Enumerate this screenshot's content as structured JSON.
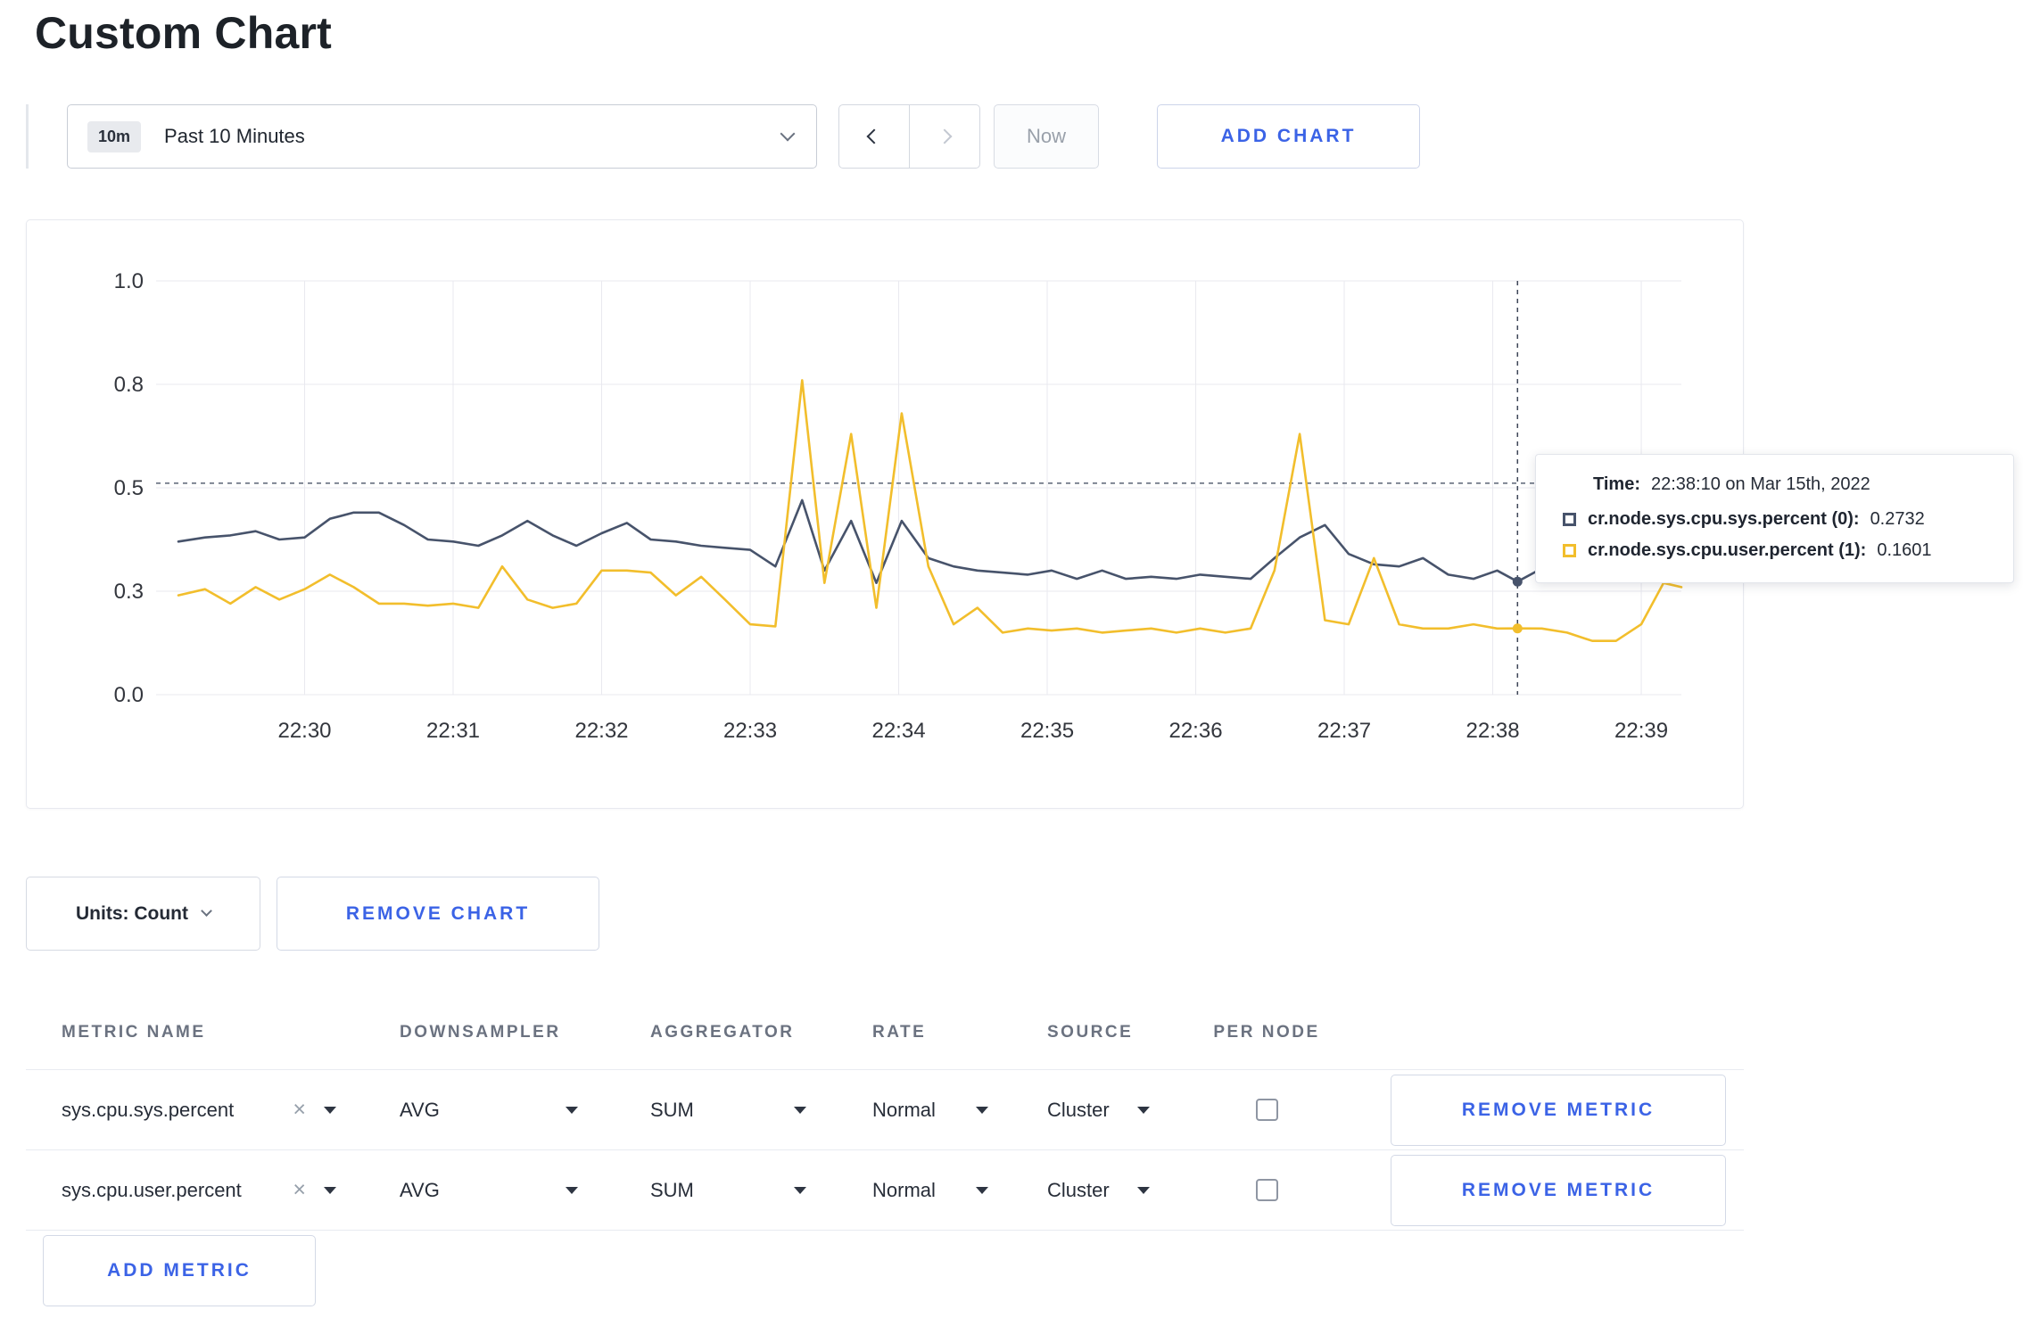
{
  "page": {
    "title": "Custom Chart"
  },
  "toolbar": {
    "time_badge": "10m",
    "time_label": "Past 10 Minutes",
    "now_label": "Now",
    "add_chart_label": "ADD CHART"
  },
  "tooltip": {
    "time_label": "Time:",
    "time_value": "22:38:10 on Mar 15th, 2022",
    "series": [
      {
        "name": "cr.node.sys.cpu.sys.percent (0):",
        "value": "0.2732",
        "color": "#47536b"
      },
      {
        "name": "cr.node.sys.cpu.user.percent (1):",
        "value": "0.1601",
        "color": "#F2BE2C"
      }
    ]
  },
  "chart_footer": {
    "units_label": "Units: Count",
    "remove_chart_label": "REMOVE CHART"
  },
  "metrics_table": {
    "headers": [
      "METRIC NAME",
      "DOWNSAMPLER",
      "AGGREGATOR",
      "RATE",
      "SOURCE",
      "PER NODE"
    ],
    "rows": [
      {
        "metric": "sys.cpu.sys.percent",
        "downsampler": "AVG",
        "aggregator": "SUM",
        "rate": "Normal",
        "source": "Cluster",
        "per_node": false,
        "action": "REMOVE METRIC"
      },
      {
        "metric": "sys.cpu.user.percent",
        "downsampler": "AVG",
        "aggregator": "SUM",
        "rate": "Normal",
        "source": "Cluster",
        "per_node": false,
        "action": "REMOVE METRIC"
      }
    ],
    "add_metric_label": "ADD METRIC"
  },
  "chart_data": {
    "type": "line",
    "ylim": [
      0,
      1
    ],
    "x_range_minutes": [
      -1.0,
      9.27
    ],
    "x_ticks": [
      "22:30",
      "22:31",
      "22:32",
      "22:33",
      "22:34",
      "22:35",
      "22:36",
      "22:37",
      "22:38",
      "22:39"
    ],
    "y_ticks": [
      {
        "label": "1.0",
        "value": 1.0
      },
      {
        "label": "0.8",
        "value": 0.75
      },
      {
        "label": "0.5",
        "value": 0.5
      },
      {
        "label": "0.3",
        "value": 0.25
      },
      {
        "label": "0.0",
        "value": 0.0
      }
    ],
    "grid": true,
    "crosshair": {
      "t_minutes": 8.1667,
      "time": "22:38:10",
      "hline_value": 0.511,
      "values": [
        0.2732,
        0.1601
      ]
    },
    "series": [
      {
        "name": "cr.node.sys.cpu.sys.percent",
        "color": "#47536b",
        "points": [
          [
            -0.85,
            0.37
          ],
          [
            -0.67,
            0.38
          ],
          [
            -0.5,
            0.385
          ],
          [
            -0.33,
            0.395
          ],
          [
            -0.17,
            0.375
          ],
          [
            0.0,
            0.38
          ],
          [
            0.17,
            0.425
          ],
          [
            0.33,
            0.44
          ],
          [
            0.5,
            0.44
          ],
          [
            0.67,
            0.41
          ],
          [
            0.83,
            0.375
          ],
          [
            1.0,
            0.37
          ],
          [
            1.17,
            0.36
          ],
          [
            1.33,
            0.385
          ],
          [
            1.5,
            0.42
          ],
          [
            1.67,
            0.385
          ],
          [
            1.83,
            0.36
          ],
          [
            2.0,
            0.39
          ],
          [
            2.17,
            0.415
          ],
          [
            2.33,
            0.375
          ],
          [
            2.5,
            0.37
          ],
          [
            2.67,
            0.36
          ],
          [
            2.83,
            0.355
          ],
          [
            3.0,
            0.35
          ],
          [
            3.17,
            0.31
          ],
          [
            3.35,
            0.47
          ],
          [
            3.5,
            0.3
          ],
          [
            3.68,
            0.42
          ],
          [
            3.85,
            0.27
          ],
          [
            4.02,
            0.42
          ],
          [
            4.2,
            0.33
          ],
          [
            4.37,
            0.31
          ],
          [
            4.53,
            0.3
          ],
          [
            4.7,
            0.295
          ],
          [
            4.87,
            0.29
          ],
          [
            5.03,
            0.3
          ],
          [
            5.2,
            0.28
          ],
          [
            5.37,
            0.3
          ],
          [
            5.53,
            0.28
          ],
          [
            5.7,
            0.285
          ],
          [
            5.87,
            0.28
          ],
          [
            6.03,
            0.29
          ],
          [
            6.2,
            0.285
          ],
          [
            6.37,
            0.28
          ],
          [
            6.53,
            0.33
          ],
          [
            6.7,
            0.38
          ],
          [
            6.87,
            0.41
          ],
          [
            7.03,
            0.34
          ],
          [
            7.2,
            0.315
          ],
          [
            7.37,
            0.31
          ],
          [
            7.53,
            0.33
          ],
          [
            7.7,
            0.29
          ],
          [
            7.87,
            0.28
          ],
          [
            8.03,
            0.3
          ],
          [
            8.1667,
            0.2732
          ],
          [
            8.33,
            0.305
          ],
          [
            8.5,
            0.29
          ],
          [
            8.67,
            0.285
          ],
          [
            8.83,
            0.29
          ],
          [
            9.0,
            0.3
          ],
          [
            9.15,
            0.29
          ],
          [
            9.27,
            0.3
          ]
        ]
      },
      {
        "name": "cr.node.sys.cpu.user.percent",
        "color": "#F2BE2C",
        "points": [
          [
            -0.85,
            0.24
          ],
          [
            -0.67,
            0.255
          ],
          [
            -0.5,
            0.22
          ],
          [
            -0.33,
            0.26
          ],
          [
            -0.17,
            0.23
          ],
          [
            0.0,
            0.255
          ],
          [
            0.17,
            0.29
          ],
          [
            0.33,
            0.26
          ],
          [
            0.5,
            0.22
          ],
          [
            0.67,
            0.22
          ],
          [
            0.83,
            0.215
          ],
          [
            1.0,
            0.22
          ],
          [
            1.17,
            0.21
          ],
          [
            1.33,
            0.31
          ],
          [
            1.5,
            0.23
          ],
          [
            1.67,
            0.21
          ],
          [
            1.83,
            0.22
          ],
          [
            2.0,
            0.3
          ],
          [
            2.17,
            0.3
          ],
          [
            2.33,
            0.295
          ],
          [
            2.5,
            0.24
          ],
          [
            2.67,
            0.285
          ],
          [
            2.83,
            0.23
          ],
          [
            3.0,
            0.17
          ],
          [
            3.17,
            0.165
          ],
          [
            3.35,
            0.76
          ],
          [
            3.5,
            0.27
          ],
          [
            3.68,
            0.63
          ],
          [
            3.85,
            0.21
          ],
          [
            4.02,
            0.68
          ],
          [
            4.2,
            0.31
          ],
          [
            4.37,
            0.17
          ],
          [
            4.53,
            0.21
          ],
          [
            4.7,
            0.15
          ],
          [
            4.87,
            0.16
          ],
          [
            5.03,
            0.155
          ],
          [
            5.2,
            0.16
          ],
          [
            5.37,
            0.15
          ],
          [
            5.53,
            0.155
          ],
          [
            5.7,
            0.16
          ],
          [
            5.87,
            0.15
          ],
          [
            6.03,
            0.16
          ],
          [
            6.2,
            0.15
          ],
          [
            6.37,
            0.16
          ],
          [
            6.53,
            0.3
          ],
          [
            6.7,
            0.63
          ],
          [
            6.87,
            0.18
          ],
          [
            7.03,
            0.17
          ],
          [
            7.2,
            0.33
          ],
          [
            7.37,
            0.17
          ],
          [
            7.53,
            0.16
          ],
          [
            7.7,
            0.16
          ],
          [
            7.87,
            0.17
          ],
          [
            8.03,
            0.16
          ],
          [
            8.1667,
            0.1601
          ],
          [
            8.33,
            0.16
          ],
          [
            8.5,
            0.15
          ],
          [
            8.67,
            0.13
          ],
          [
            8.83,
            0.13
          ],
          [
            9.0,
            0.17
          ],
          [
            9.15,
            0.27
          ],
          [
            9.27,
            0.26
          ]
        ]
      }
    ]
  }
}
